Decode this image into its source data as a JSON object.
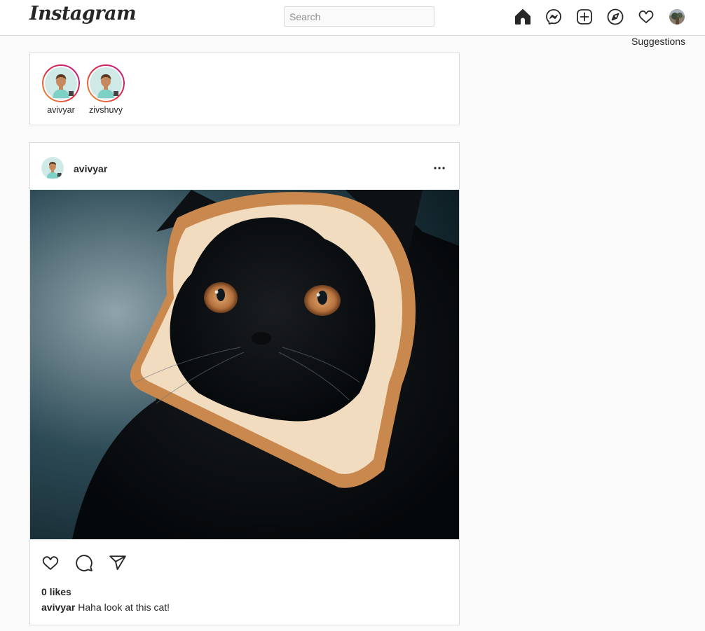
{
  "header": {
    "logo": "Instagram",
    "search_placeholder": "Search",
    "icons": [
      "home-icon",
      "messenger-icon",
      "new-post-icon",
      "explore-icon",
      "activity-heart-icon",
      "profile-avatar"
    ]
  },
  "sidebar": {
    "suggestions_label": "Suggestions"
  },
  "stories": [
    {
      "username": "avivyar"
    },
    {
      "username": "zivshuvy"
    }
  ],
  "post": {
    "username": "avivyar",
    "likes": "0 likes",
    "caption_user": "avivyar",
    "caption_text": "Haha look at this cat!",
    "actions": [
      "like-icon",
      "comment-icon",
      "share-icon"
    ]
  },
  "colors": {
    "border": "#dbdbdb",
    "background": "#fafafa",
    "text": "#262626",
    "story_ring_start": "#f09433",
    "story_ring_end": "#bc1888"
  }
}
